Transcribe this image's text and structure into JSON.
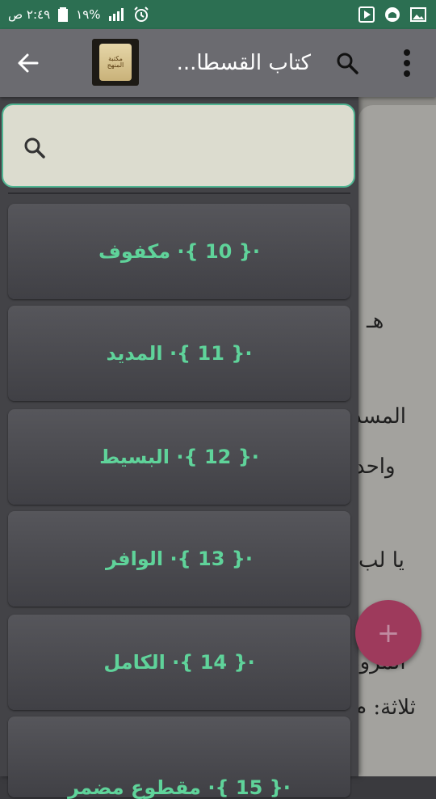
{
  "status_bar": {
    "time": "٢:٤٩ ص",
    "battery": "١٩%",
    "icons": [
      "alarm-icon",
      "signal-icon",
      "battery-icon",
      "play-store-icon",
      "mosque-app-icon",
      "image-icon"
    ]
  },
  "app_bar": {
    "title": "كتاب القسطا...",
    "book_icon_text": "مكتبة المنهج",
    "back_icon": "arrow-left-icon",
    "search_icon": "search-icon",
    "more_icon": "more-vert-icon"
  },
  "drawer": {
    "search": {
      "placeholder": "",
      "value": ""
    },
    "items": [
      {
        "label": "·{ 10 }· مكفوف"
      },
      {
        "label": "·{ 11 }· المديد"
      },
      {
        "label": "·{ 12 }· البسيط"
      },
      {
        "label": "·{ 13 }· الوافر"
      },
      {
        "label": "·{ 14 }· الكامل"
      },
      {
        "label": "·{ 15 }· مقطوع مضمر"
      }
    ]
  },
  "content_peek": {
    "lines": [
      "هـ",
      "المسد",
      "واحد",
      "يا لب",
      "المرود",
      "ثلاثة: م"
    ]
  },
  "fab": {
    "symbol": "+"
  },
  "colors": {
    "status_bar": "#2c6f52",
    "app_bar": "#6b6b70",
    "drawer_bg": "#434347",
    "item_text": "#5fd39a",
    "search_border": "#4fb592",
    "fab": "#9e3a5c"
  }
}
